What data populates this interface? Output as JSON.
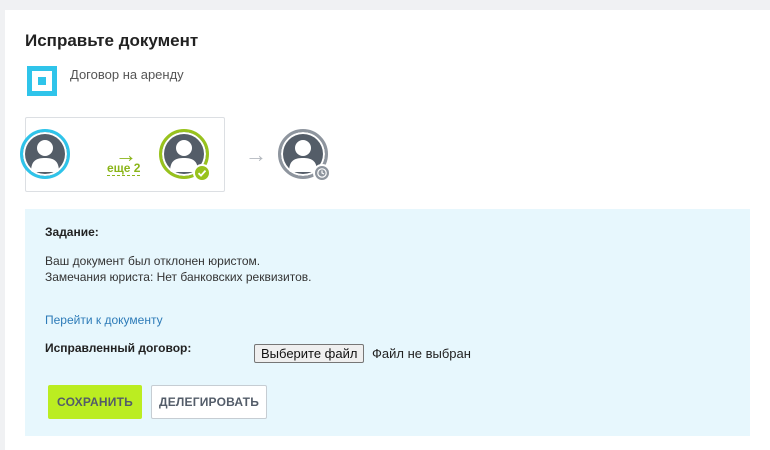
{
  "page": {
    "title": "Исправьте документ",
    "document_name": "Договор на аренду"
  },
  "workflow": {
    "more_link": "еще 2",
    "colors": {
      "active": "#2fc4ea",
      "done": "#98c21d",
      "pending": "#8e959e"
    }
  },
  "task": {
    "label": "Задание:",
    "line1": "Ваш документ был отклонен юристом.",
    "line2": "Замечания юриста: Нет банковских реквизитов.",
    "doc_link": "Перейти к документу",
    "field_label": "Исправленный договор:",
    "file_button": "Выберите файл",
    "file_status": "Файл не выбран"
  },
  "actions": {
    "save": "СОХРАНИТЬ",
    "delegate": "ДЕЛЕГИРОВАТЬ",
    "save_color": "#bbed21"
  }
}
